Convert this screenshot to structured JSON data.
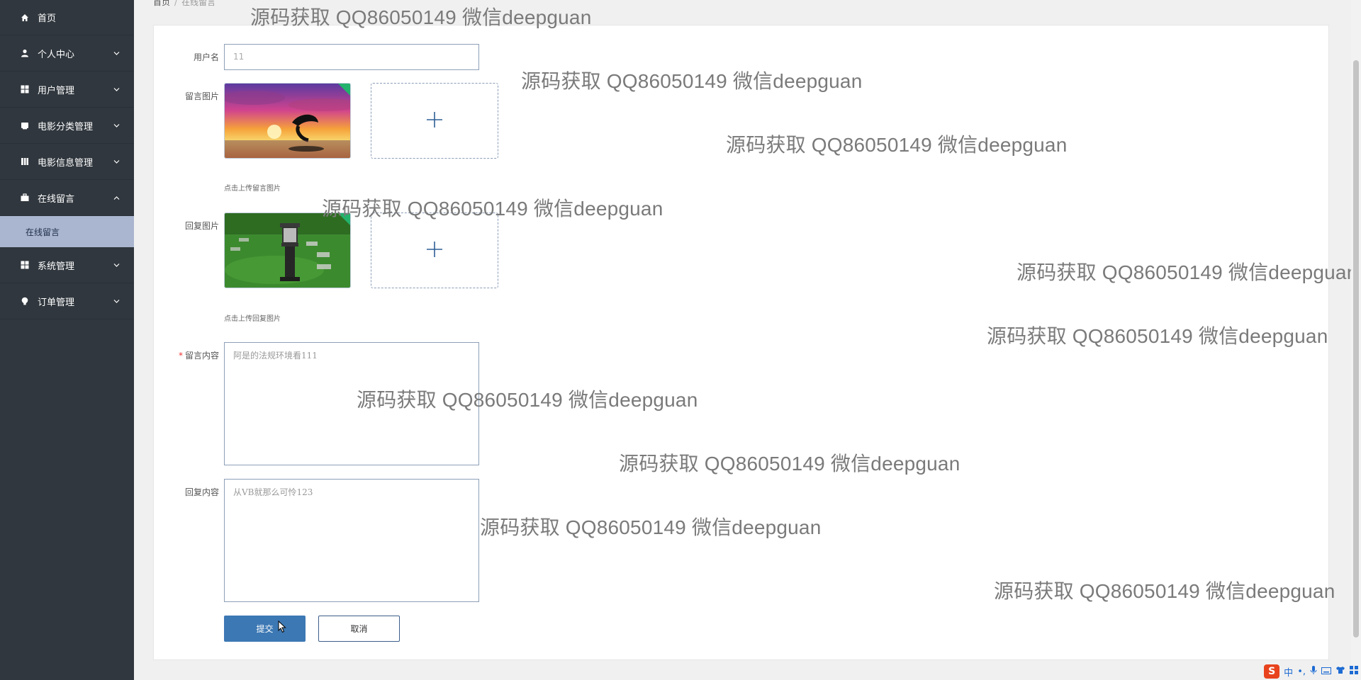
{
  "sidebar": {
    "items": [
      {
        "label": "首页",
        "icon": "home-icon",
        "has_chevron": false
      },
      {
        "label": "个人中心",
        "icon": "user-icon",
        "has_chevron": true
      },
      {
        "label": "用户管理",
        "icon": "grid-icon",
        "has_chevron": true
      },
      {
        "label": "电影分类管理",
        "icon": "folder-icon",
        "has_chevron": true
      },
      {
        "label": "电影信息管理",
        "icon": "film-icon",
        "has_chevron": true
      },
      {
        "label": "在线留言",
        "icon": "briefcase-icon",
        "has_chevron": true,
        "expanded": true
      },
      {
        "label": "系统管理",
        "icon": "grid-icon",
        "has_chevron": true
      },
      {
        "label": "订单管理",
        "icon": "bulb-icon",
        "has_chevron": true
      }
    ],
    "submenu": {
      "label": "在线留言",
      "active": true
    }
  },
  "breadcrumb": {
    "home": "首页",
    "separator": "/",
    "current": "在线留言"
  },
  "form": {
    "username": {
      "label": "用户名",
      "value": "11"
    },
    "message_image": {
      "label": "留言图片",
      "hint": "点击上传留言图片"
    },
    "reply_image": {
      "label": "回复图片",
      "hint": "点击上传回复图片"
    },
    "message_content": {
      "label": "留言内容",
      "required": true,
      "value": "阿是的法规环境看111"
    },
    "reply_content": {
      "label": "回复内容",
      "value": "从VB就那么可怜123"
    },
    "submit_label": "提交",
    "cancel_label": "取消"
  },
  "watermark": {
    "text": "源码获取 QQ86050149 微信deepguan"
  },
  "tray": {
    "ime_label": "中",
    "punct_label": "•,"
  },
  "colors": {
    "sidebar_bg": "#30373e",
    "submenu_active_bg": "#aab6cf",
    "primary": "#3c78b4",
    "required": "#e33"
  }
}
